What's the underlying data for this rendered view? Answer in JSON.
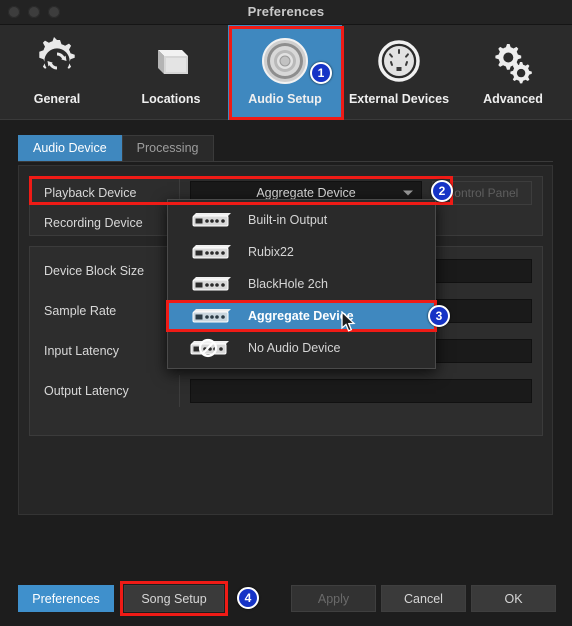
{
  "window": {
    "title": "Preferences",
    "traffic_lights": [
      "close",
      "minimize",
      "zoom"
    ]
  },
  "toolbar": {
    "items": [
      {
        "label": "General",
        "icon": "gear-refresh-icon",
        "selected": false
      },
      {
        "label": "Locations",
        "icon": "drive-box-icon",
        "selected": false
      },
      {
        "label": "Audio Setup",
        "icon": "speaker-driver-icon",
        "selected": true
      },
      {
        "label": "External Devices",
        "icon": "midi-din-icon",
        "selected": false
      },
      {
        "label": "Advanced",
        "icon": "double-gear-icon",
        "selected": false
      }
    ]
  },
  "tabs": [
    {
      "label": "Audio Device",
      "active": true
    },
    {
      "label": "Processing",
      "active": false
    }
  ],
  "settings": {
    "playback_device": {
      "label": "Playback Device",
      "value": "Aggregate Device",
      "control_panel_button": "Control Panel"
    },
    "recording_device": {
      "label": "Recording Device",
      "value": ""
    },
    "rows": [
      {
        "label": "Device Block Size",
        "value": ""
      },
      {
        "label": "Sample Rate",
        "value": ""
      },
      {
        "label": "Input Latency",
        "value": ""
      },
      {
        "label": "Output Latency",
        "value": ""
      }
    ]
  },
  "dropdown": {
    "open": true,
    "items": [
      {
        "label": "Built-in Output",
        "icon": "audio-interface-icon",
        "selected": false
      },
      {
        "label": "Rubix22",
        "icon": "audio-interface-icon",
        "selected": false
      },
      {
        "label": "BlackHole 2ch",
        "icon": "audio-interface-icon",
        "selected": false
      },
      {
        "label": "Aggregate Device",
        "icon": "audio-interface-icon",
        "selected": true
      },
      {
        "label": "No Audio Device",
        "icon": "no-audio-device-icon",
        "selected": false
      }
    ]
  },
  "footer": {
    "preferences": "Preferences",
    "song_setup": "Song Setup",
    "apply": "Apply",
    "cancel": "Cancel",
    "ok": "OK"
  },
  "annotations": {
    "step1": "1",
    "step2": "2",
    "step3": "3",
    "step4": "4",
    "highlight_color": "#ef1b16",
    "badge_color": "#1633c6",
    "accent_color": "#3f88bf"
  }
}
